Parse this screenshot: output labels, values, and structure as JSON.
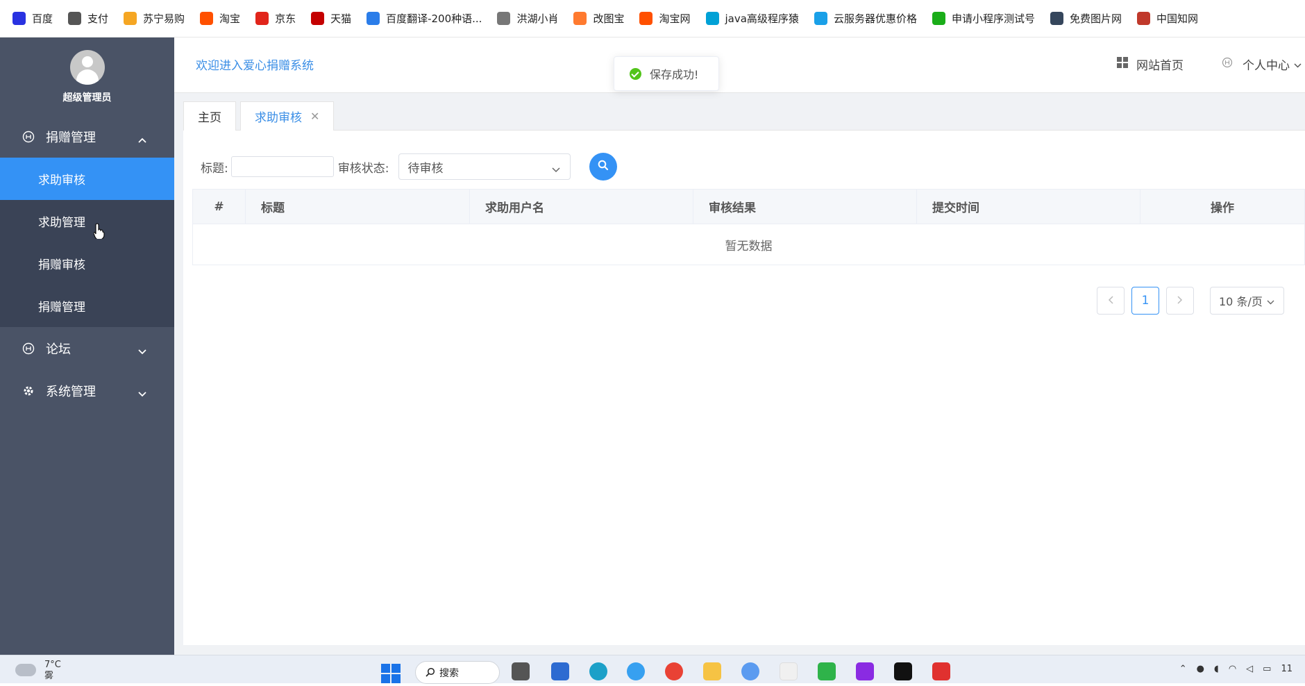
{
  "bookmarks": [
    {
      "label": "百度",
      "icon": "baidu-paw-icon",
      "color": "#2932e1"
    },
    {
      "label": "支付",
      "icon": "globe-icon",
      "color": "#555555"
    },
    {
      "label": "苏宁易购",
      "icon": "suning-icon",
      "color": "#f5a623"
    },
    {
      "label": "淘宝",
      "icon": "taobao-icon",
      "color": "#ff5000"
    },
    {
      "label": "京东",
      "icon": "jd-icon",
      "color": "#e1251b"
    },
    {
      "label": "天猫",
      "icon": "tmall-icon",
      "color": "#c40000"
    },
    {
      "label": "百度翻译-200种语...",
      "icon": "translate-icon",
      "color": "#2b7de9"
    },
    {
      "label": "洪湖小肖",
      "icon": "bird-icon",
      "color": "#777777"
    },
    {
      "label": "改图宝",
      "icon": "gaitubao-icon",
      "color": "#ff7a2f"
    },
    {
      "label": "淘宝网",
      "icon": "taobao-icon",
      "color": "#ff5000"
    },
    {
      "label": "java高级程序猿",
      "icon": "bilibili-icon",
      "color": "#00a1d6"
    },
    {
      "label": "云服务器优惠价格",
      "icon": "cloud-icon",
      "color": "#1aa0e8"
    },
    {
      "label": "申请小程序测试号",
      "icon": "wechat-icon",
      "color": "#1aad19"
    },
    {
      "label": "免费图片网",
      "icon": "tumblr-icon",
      "color": "#35465c"
    },
    {
      "label": "中国知网",
      "icon": "cnki-icon",
      "color": "#c0392b"
    }
  ],
  "sidebar": {
    "user": "超级管理员",
    "groups": [
      {
        "label": "捐赠管理",
        "icon": "donation-icon",
        "expanded": true,
        "items": [
          {
            "label": "求助审核",
            "active": true
          },
          {
            "label": "求助管理"
          },
          {
            "label": "捐赠审核"
          },
          {
            "label": "捐赠管理"
          }
        ]
      },
      {
        "label": "论坛",
        "icon": "forum-icon",
        "expanded": false
      },
      {
        "label": "系统管理",
        "icon": "gear-icon",
        "expanded": false
      }
    ]
  },
  "header": {
    "welcome": "欢迎进入爱心捐赠系统",
    "home_link": "网站首页",
    "profile_link": "个人中心"
  },
  "toast": {
    "message": "保存成功!"
  },
  "tabs": [
    {
      "label": "主页",
      "active": false
    },
    {
      "label": "求助审核",
      "active": true
    }
  ],
  "filter": {
    "title_label": "标题:",
    "title_value": "",
    "status_label": "审核状态:",
    "status_value": "待审核"
  },
  "table": {
    "columns": [
      "#",
      "标题",
      "求助用户名",
      "审核结果",
      "提交时间",
      "操作"
    ],
    "empty_text": "暂无数据"
  },
  "pagination": {
    "current_page": "1",
    "page_size": "10 条/页"
  },
  "taskbar": {
    "temperature": "7°C",
    "weather_text": "雾",
    "search_label": "搜索",
    "clock": "11"
  },
  "colors": {
    "primary": "#3492f5",
    "sidebar": "#4a5366",
    "submenu": "#3a4356"
  }
}
